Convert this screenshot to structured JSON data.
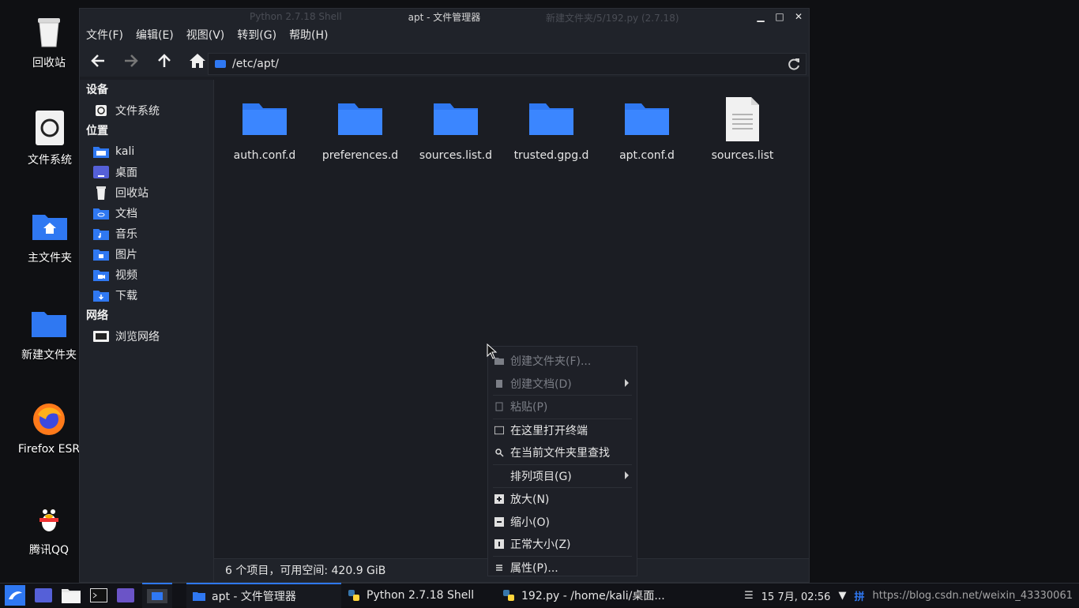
{
  "desktop": {
    "icons": [
      {
        "label": "回收站"
      },
      {
        "label": "文件系统"
      },
      {
        "label": "主文件夹"
      },
      {
        "label": "新建文件夹"
      },
      {
        "label": "Firefox ESR"
      },
      {
        "label": "腾讯QQ"
      }
    ]
  },
  "background_window": {
    "left_title": "Python 2.7.18 Shell",
    "right_title": "新建文件夹/5/192.py (2.7.18)"
  },
  "window": {
    "title": "apt - 文件管理器",
    "menu": [
      "文件(F)",
      "编辑(E)",
      "视图(V)",
      "转到(G)",
      "帮助(H)"
    ],
    "address": "/etc/apt/",
    "sidebar": {
      "devices_header": "设备",
      "devices": [
        {
          "label": "文件系统"
        }
      ],
      "places_header": "位置",
      "places": [
        {
          "label": "kali"
        },
        {
          "label": "桌面"
        },
        {
          "label": "回收站"
        },
        {
          "label": "文档"
        },
        {
          "label": "音乐"
        },
        {
          "label": "图片"
        },
        {
          "label": "视频"
        },
        {
          "label": "下载"
        }
      ],
      "network_header": "网络",
      "network": [
        {
          "label": "浏览网络"
        }
      ]
    },
    "files": [
      {
        "name": "auth.conf.d",
        "type": "folder"
      },
      {
        "name": "preferences.d",
        "type": "folder"
      },
      {
        "name": "sources.list.d",
        "type": "folder"
      },
      {
        "name": "trusted.gpg.d",
        "type": "folder"
      },
      {
        "name": "apt.conf.d",
        "type": "folder"
      },
      {
        "name": "sources.list",
        "type": "file"
      }
    ],
    "status": "6 个项目，可用空间: 420.9 GiB"
  },
  "context_menu": {
    "items": [
      {
        "label": "创建文件夹(F)...",
        "disabled": true
      },
      {
        "label": "创建文档(D)",
        "disabled": true,
        "submenu": true
      },
      {
        "label": "粘贴(P)",
        "disabled": true
      },
      {
        "label": "在这里打开终端"
      },
      {
        "label": "在当前文件夹里查找"
      },
      {
        "label": "排列项目(G)",
        "submenu": true
      },
      {
        "label": "放大(N)"
      },
      {
        "label": "缩小(O)"
      },
      {
        "label": "正常大小(Z)"
      },
      {
        "label": "属性(P)..."
      }
    ]
  },
  "taskbar": {
    "tasks": [
      {
        "label": "apt - 文件管理器"
      },
      {
        "label": "Python 2.7.18 Shell"
      },
      {
        "label": "192.py - /home/kali/桌面..."
      }
    ],
    "clock": "15 7月, 02:56",
    "ime": "拼",
    "watermark": "https://blog.csdn.net/weixin_43330061"
  },
  "colors": {
    "accent": "#2f78f2",
    "window_bg": "#1b1d23",
    "panel_bg": "#20232a"
  }
}
